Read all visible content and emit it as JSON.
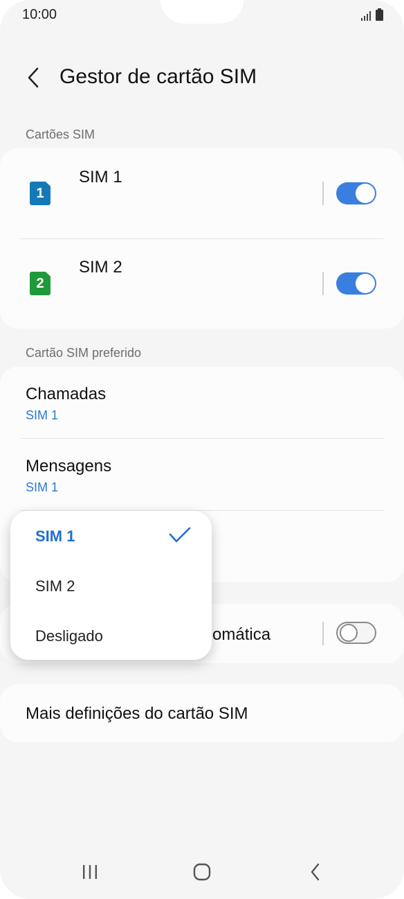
{
  "status": {
    "time": "10:00",
    "signal_icon": "signal-icon",
    "battery_icon": "battery-icon"
  },
  "header": {
    "title": "Gestor de cartão SIM",
    "back_icon": "back-arrow-icon"
  },
  "sim_cards": {
    "section_label": "Cartões SIM",
    "items": [
      {
        "badge": "1",
        "name": "SIM 1",
        "enabled": true,
        "badge_color": "#1479b8"
      },
      {
        "badge": "2",
        "name": "SIM 2",
        "enabled": true,
        "badge_color": "#1f9a3a"
      }
    ]
  },
  "preferred": {
    "section_label": "Cartão SIM preferido",
    "items": [
      {
        "title": "Chamadas",
        "value": "SIM 1"
      },
      {
        "title": "Mensagens",
        "value": "SIM 1"
      }
    ]
  },
  "auto_switch": {
    "label_visible_part": "omática",
    "enabled": false
  },
  "more": {
    "title": "Mais definições do cartão SIM"
  },
  "popup": {
    "options": [
      "SIM 1",
      "SIM 2",
      "Desligado"
    ],
    "selected": "SIM 1"
  },
  "colors": {
    "accent": "#3a7fe0",
    "link": "#2a78d2",
    "background": "#f5f5f5",
    "card": "#fcfcfc"
  },
  "nav": {
    "recents_icon": "recents-icon",
    "home_icon": "home-icon",
    "back_icon": "back-icon"
  }
}
